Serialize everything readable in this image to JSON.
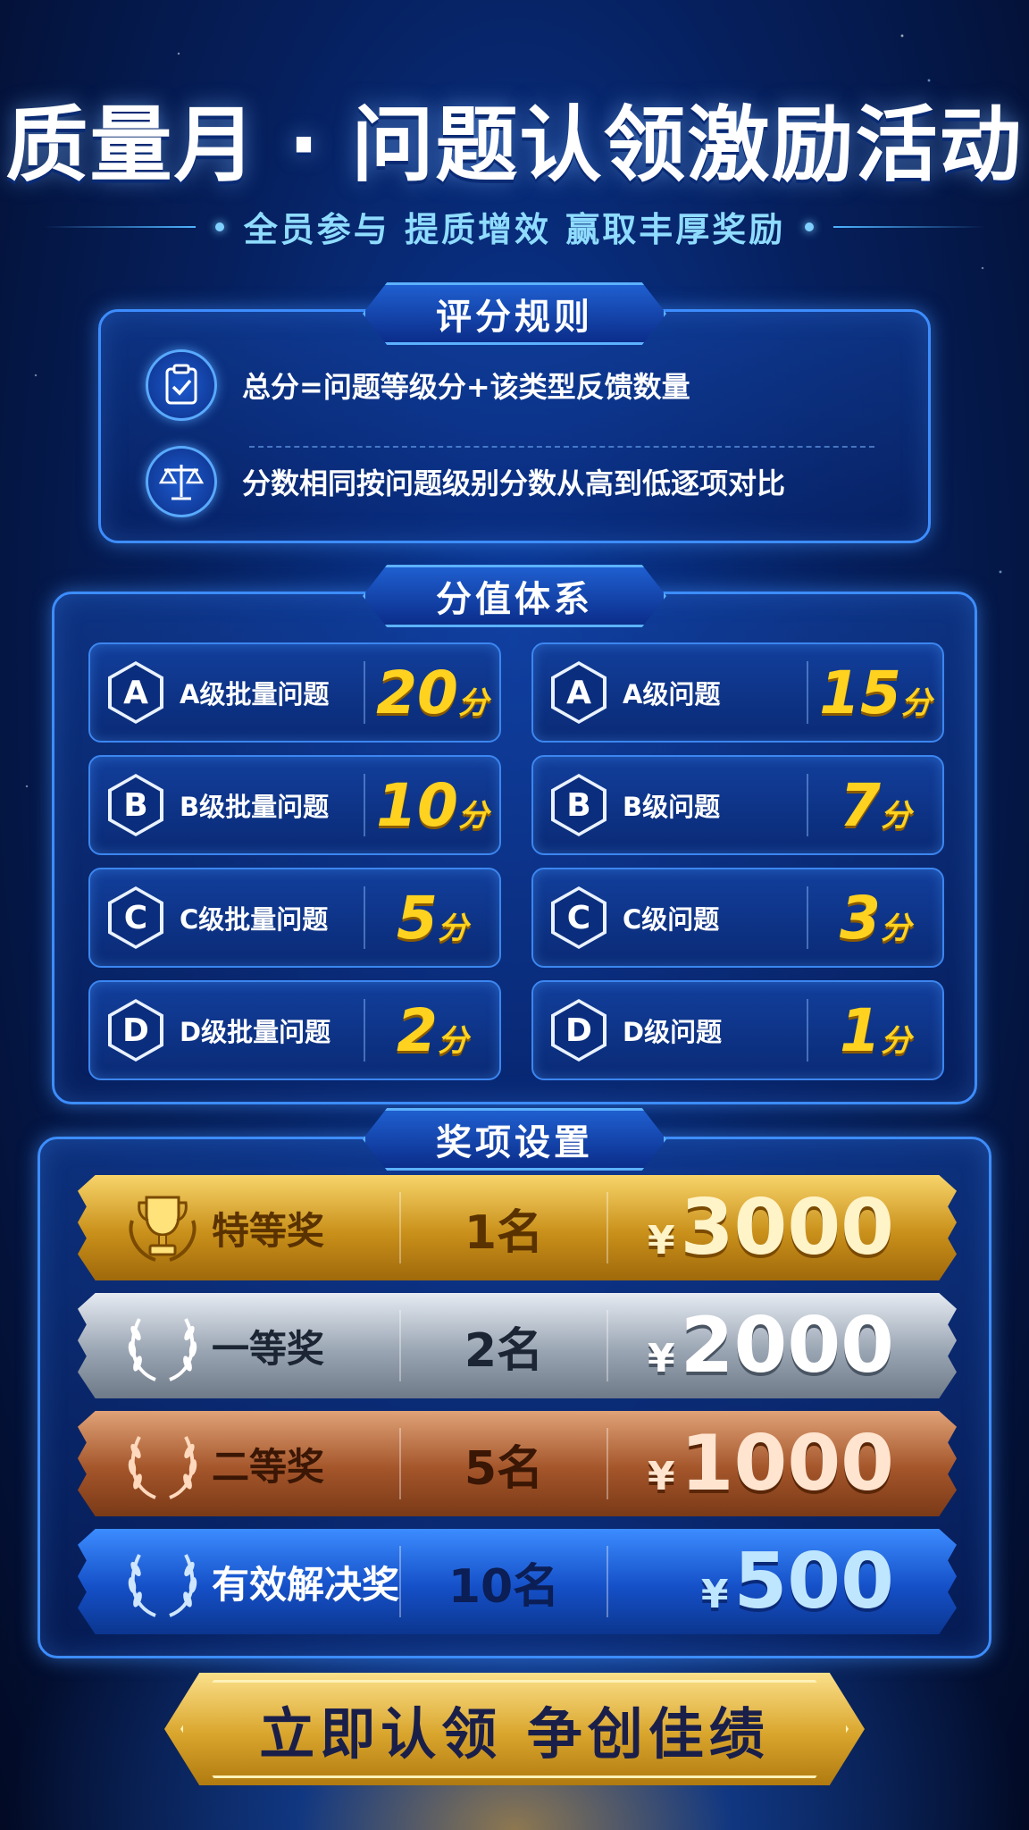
{
  "header": {
    "title": "质量月 · 问题认领激励活动",
    "subtitle": "全员参与  提质增效  赢取丰厚奖励"
  },
  "rules": {
    "heading": "评分规则",
    "items": [
      {
        "icon": "clipboard-check-icon",
        "text": "总分=问题等级分+该类型反馈数量"
      },
      {
        "icon": "balance-scale-icon",
        "text": "分数相同按问题级别分数从高到低逐项对比"
      }
    ]
  },
  "scores": {
    "heading": "分值体系",
    "unit": "分",
    "left": [
      {
        "grade": "A",
        "label": "A级批量问题",
        "points": "20"
      },
      {
        "grade": "B",
        "label": "B级批量问题",
        "points": "10"
      },
      {
        "grade": "C",
        "label": "C级批量问题",
        "points": "5"
      },
      {
        "grade": "D",
        "label": "D级批量问题",
        "points": "2"
      }
    ],
    "right": [
      {
        "grade": "A",
        "label": "A级问题",
        "points": "15"
      },
      {
        "grade": "B",
        "label": "B级问题",
        "points": "7"
      },
      {
        "grade": "C",
        "label": "C级问题",
        "points": "3"
      },
      {
        "grade": "D",
        "label": "D级问题",
        "points": "1"
      }
    ]
  },
  "awards": {
    "heading": "奖项设置",
    "currency": "¥",
    "items": [
      {
        "name": "特等奖",
        "count": "1名",
        "amount": "3000",
        "icon": "trophy-icon",
        "color": "#c9901a"
      },
      {
        "name": "一等奖",
        "count": "2名",
        "amount": "2000",
        "icon": "laurel-wreath-icon",
        "color": "#9aa5b3"
      },
      {
        "name": "二等奖",
        "count": "5名",
        "amount": "1000",
        "icon": "laurel-wreath-icon",
        "color": "#a4552a"
      },
      {
        "name": "有效解决奖",
        "count": "10名",
        "amount": "500",
        "icon": "laurel-wreath-icon",
        "color": "#1550c8"
      }
    ]
  },
  "cta": {
    "label": "立即认领  争创佳绩"
  }
}
